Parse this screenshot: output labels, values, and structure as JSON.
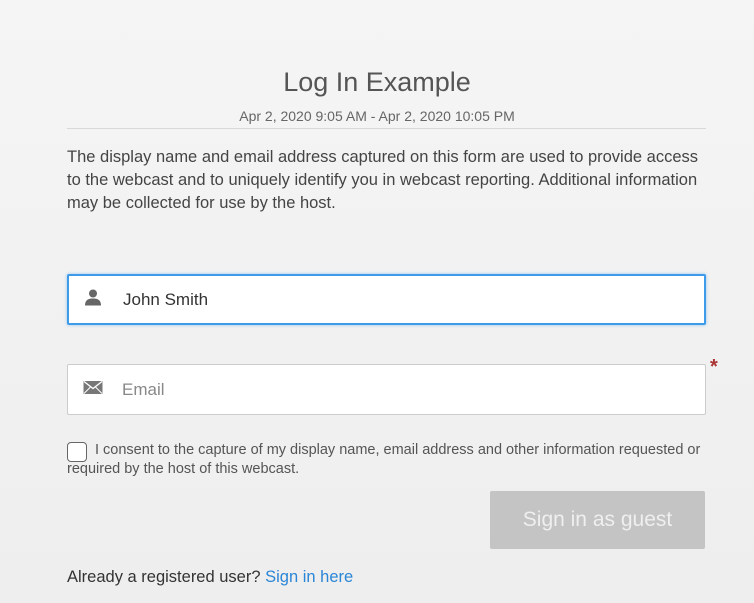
{
  "event": {
    "title": "Log In Example",
    "date_range": "Apr 2, 2020 9:05 AM - Apr 2, 2020 10:05 PM",
    "description": "The display name and email address captured on this form are used to provide access to the webcast and to uniquely identify you in webcast reporting. Additional information may be collected for use by the host."
  },
  "form": {
    "name_field": {
      "value": "John Smith",
      "icon": "user-icon"
    },
    "email_field": {
      "placeholder": "Email",
      "icon": "envelope-icon",
      "required_mark": "*"
    },
    "consent": {
      "checked": false,
      "text": "I consent to the capture of my display name, email address and other information requested or required by the host of this webcast."
    },
    "submit_label": "Sign in as guest"
  },
  "footer": {
    "prompt": "Already a registered user?",
    "link_label": "Sign in here"
  },
  "colors": {
    "accent": "#3d9be9",
    "link": "#2a86d6",
    "button_disabled": "#c4c4c4",
    "required": "#aa3333"
  }
}
